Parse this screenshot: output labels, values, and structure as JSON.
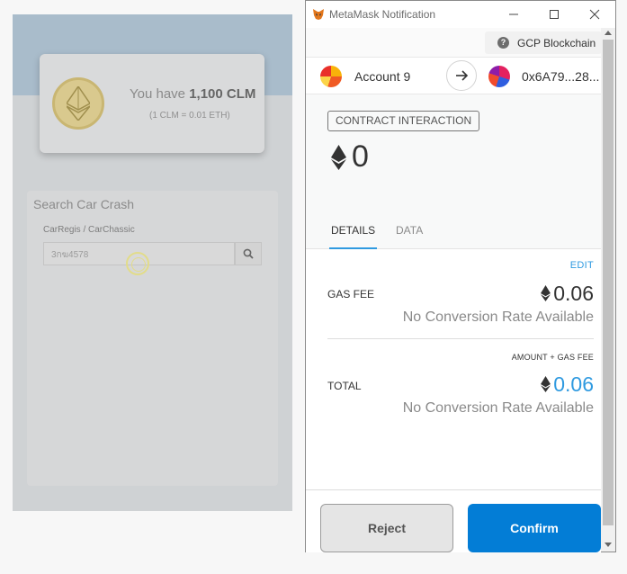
{
  "background_app": {
    "balance_prefix": "You have ",
    "balance_amount": "1,100 CLM",
    "balance_rate": "(1 CLM = 0.01 ETH)",
    "search_title": "Search Car Crash",
    "field_label": "CarRegis / CarChassic",
    "field_value": "3กฆ4578",
    "coin_icon": "ethereum-icon",
    "search_icon": "magnifier-icon"
  },
  "window": {
    "title": "MetaMask Notification",
    "controls": [
      "minimize",
      "maximize",
      "close"
    ]
  },
  "network": {
    "name": "GCP Blockchain",
    "icon": "question-circle-icon"
  },
  "accounts": {
    "from": "Account 9",
    "to": "0x6A79...28..."
  },
  "transaction": {
    "type": "CONTRACT INTERACTION",
    "amount": "0",
    "tabs": [
      "DETAILS",
      "DATA"
    ],
    "active_tab": "DETAILS"
  },
  "details": {
    "edit_label": "EDIT",
    "gas_fee_label": "GAS FEE",
    "gas_fee_value": "0.06",
    "gas_fee_conversion": "No Conversion Rate Available",
    "total_header": "AMOUNT + GAS FEE",
    "total_label": "TOTAL",
    "total_value": "0.06",
    "total_conversion": "No Conversion Rate Available"
  },
  "footer": {
    "reject_label": "Reject",
    "confirm_label": "Confirm"
  },
  "colors": {
    "accent": "#037dd6",
    "link": "#2f9ae0"
  }
}
